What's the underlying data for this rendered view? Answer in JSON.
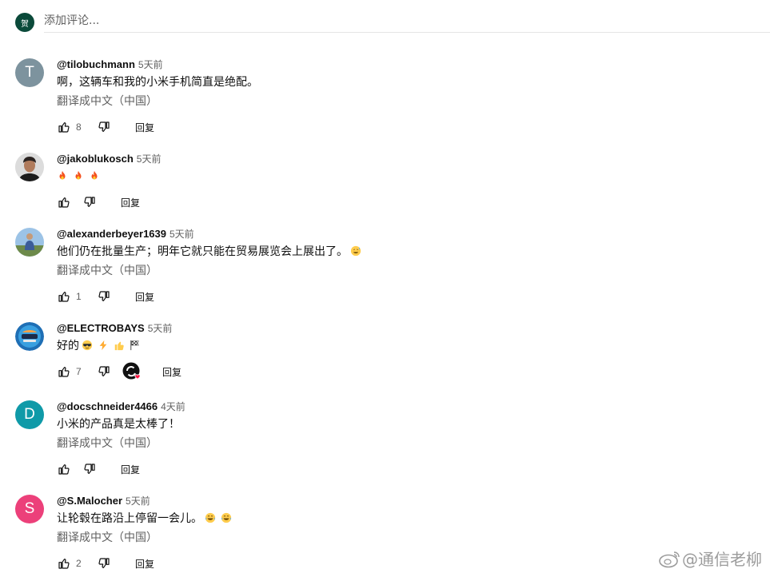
{
  "add_comment": {
    "avatar_letter": "贺",
    "placeholder": "添加评论..."
  },
  "comments": [
    {
      "author": "@tilobuchmann",
      "time": "5天前",
      "avatar_letter": "T",
      "avatar_color": "#7d939e",
      "text": "啊，这辆车和我的小米手机简直是绝配。",
      "translate": "翻译成中文（中国）",
      "likes": "8",
      "reply": "回复"
    },
    {
      "author": "@jakoblukosch",
      "time": "5天前",
      "avatar_image": "person-photo",
      "emojis": [
        "fire",
        "fire",
        "fire"
      ],
      "likes": "",
      "reply": "回复"
    },
    {
      "author": "@alexanderbeyer1639",
      "time": "5天前",
      "avatar_image": "landscape-photo",
      "text": "他们仍在批量生产；明年它就只能在贸易展览会上展出了。",
      "text_emoji": "sweat-smile",
      "translate": "翻译成中文（中国）",
      "likes": "1",
      "reply": "回复"
    },
    {
      "author": "@ELECTROBAYS",
      "time": "5天前",
      "avatar_image": "channel-logo",
      "text": "好的",
      "emojis": [
        "sunglasses",
        "lightning",
        "thumbs-up",
        "checkered-flag"
      ],
      "likes": "7",
      "creator_heart": true,
      "reply": "回复"
    },
    {
      "author": "@docschneider4466",
      "time": "4天前",
      "avatar_letter": "D",
      "avatar_color": "#0f9aa8",
      "text": "小米的产品真是太棒了！",
      "translate": "翻译成中文（中国）",
      "likes": "",
      "reply": "回复"
    },
    {
      "author": "@S.Malocher",
      "time": "5天前",
      "avatar_letter": "S",
      "avatar_color": "#ec407a",
      "text": "让轮毂在路沿上停留一会儿。",
      "emojis_after": [
        "joy",
        "joy"
      ],
      "translate": "翻译成中文（中国）",
      "likes": "2",
      "reply": "回复"
    }
  ],
  "watermark": "@通信老柳"
}
